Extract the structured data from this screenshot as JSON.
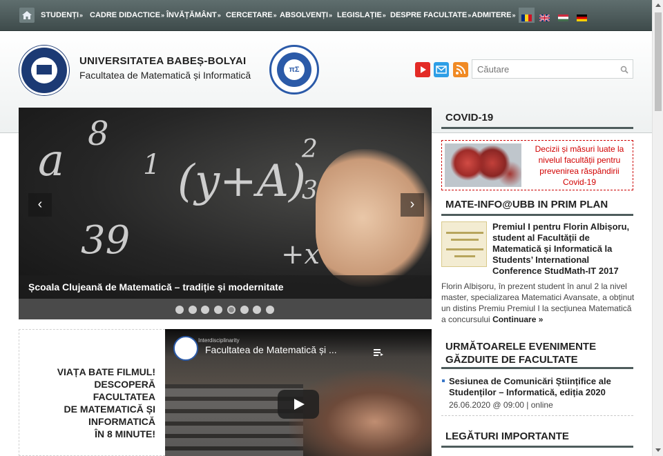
{
  "nav": {
    "items": [
      {
        "label": "STUDENȚI"
      },
      {
        "label": "CADRE DIDACTICE"
      },
      {
        "label": "ÎNVĂȚĂMÂNT"
      },
      {
        "label": "CERCETARE"
      },
      {
        "label": "ABSOLVENȚI"
      },
      {
        "label": "LEGISLAȚIE"
      },
      {
        "label": "DESPRE FACULTATE"
      },
      {
        "label": "ADMITERE"
      }
    ],
    "arrow": "»",
    "flags": [
      "romanian-flag-icon",
      "uk-flag-icon",
      "hungarian-flag-icon",
      "german-flag-icon"
    ]
  },
  "header": {
    "university": "UNIVERSITATEA BABEȘ-BOLYAI",
    "faculty": "Facultatea de Matematică și Informatică",
    "search_placeholder": "Căutare",
    "social": [
      "youtube-icon",
      "email-icon",
      "rss-icon"
    ]
  },
  "slider": {
    "caption": "Școala Clujeană de Matematică – tradiție și modernitate",
    "slide_count": 8,
    "active_slide": 5,
    "prev": "‹",
    "next": "›"
  },
  "promo": {
    "text": "VIAȚA BATE FILMUL!\nDESCOPERĂ\nFACULTATEA\nDE MATEMATICĂ ȘI\nINFORMATICĂ\nÎN 8 MINUTE!"
  },
  "video": {
    "title": "Facultatea de Matematică și ...",
    "channel_tag": "Interdisciplinarity"
  },
  "sidebar": {
    "covid_heading": "COVID-19",
    "covid_text": "Decizii și măsuri luate la nivelul facultății pentru prevenirea răspândirii Covid-19",
    "news_heading": "MATE-INFO@UBB IN PRIM PLAN",
    "news_title": "Premiul I pentru Florin Albișoru, student al Facultății de Matematică și Informatică la Students’ International Conference StudMath-IT 2017",
    "news_body": "Florin Albișoru, în prezent student în anul 2 la nivel master, specializarea Matematici Avansate, a obținut un distins Premiu Premiul I la secțiunea Matematică a concursului",
    "news_more": "Continuare »",
    "events_heading": "URMĂTOARELE EVENIMENTE GĂZDUITE DE FACULTATE",
    "event_title": "Sesiunea de Comunicări Științifice ale Studenților – Informatică, ediția 2020",
    "event_meta": "26.06.2020 @ 09:00 | online",
    "links_heading": "LEGĂTURI IMPORTANTE"
  },
  "colors": {
    "nav_bg": "#4a5757",
    "accent_red": "#d10000",
    "section_rule": "#4e5c5c"
  }
}
